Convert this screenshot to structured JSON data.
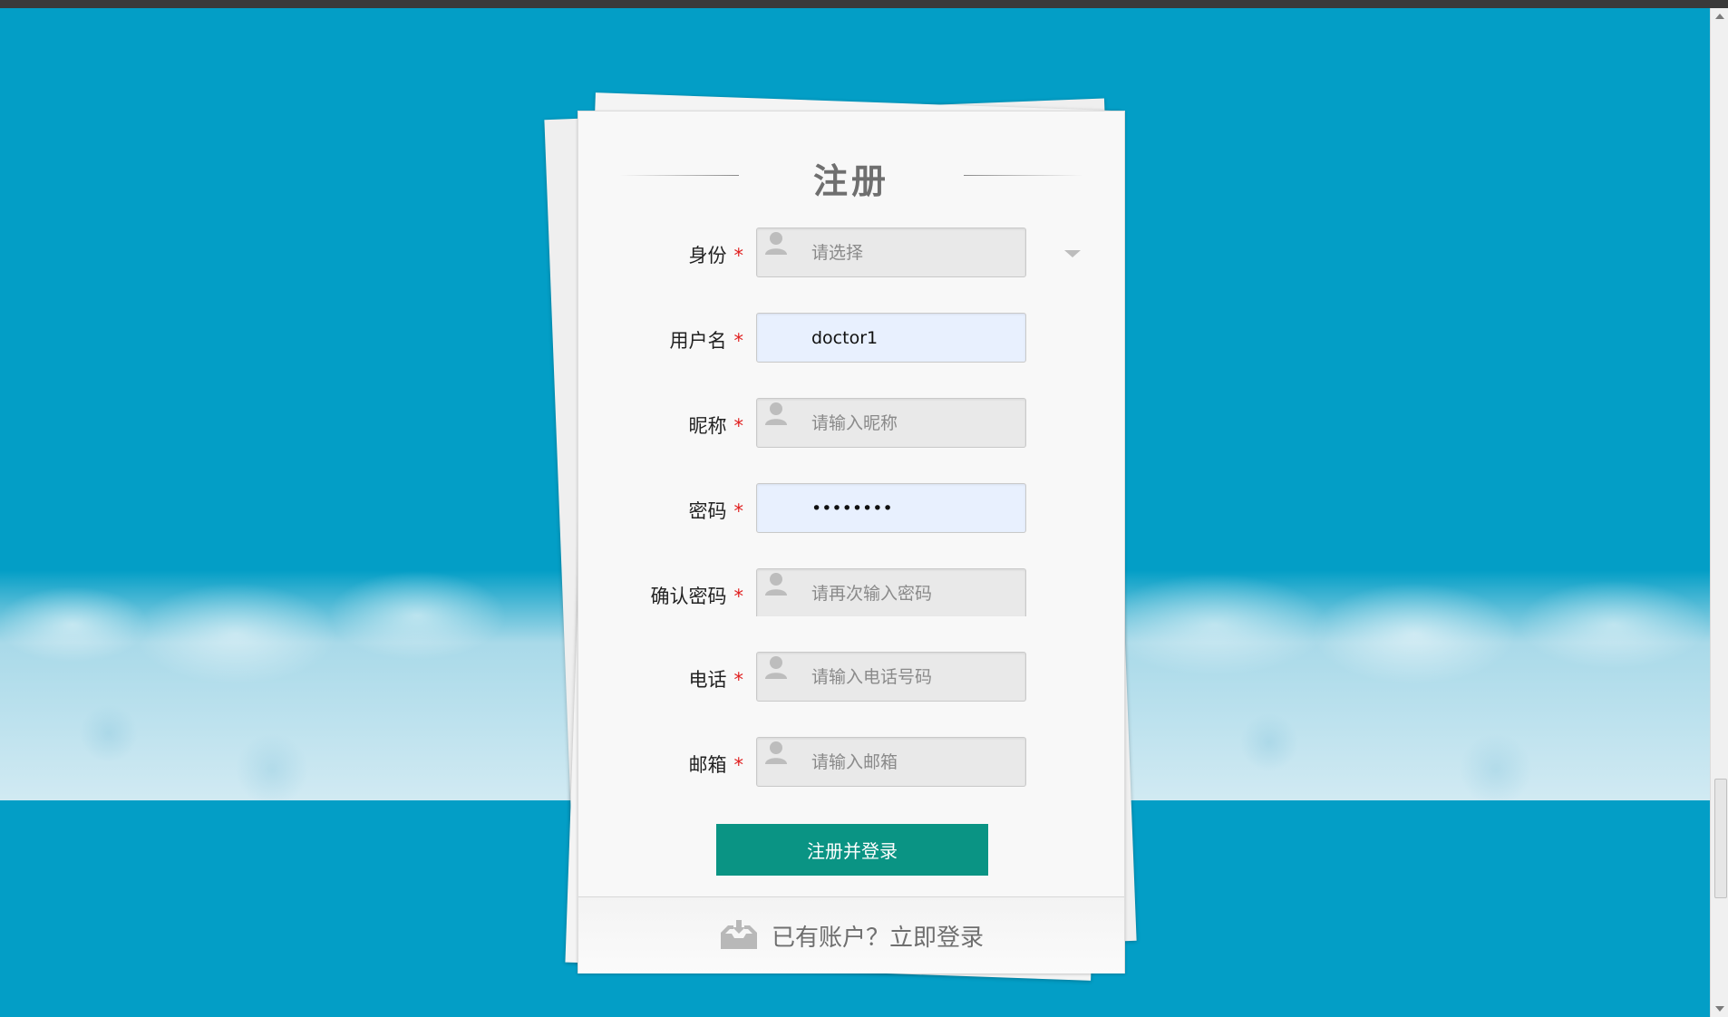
{
  "page": {
    "title": "注册",
    "submit_label": "注册并登录",
    "login_link_label": "已有账户？立即登录"
  },
  "form": {
    "required_mark": "*",
    "fields": [
      {
        "label": "身份",
        "value": "",
        "placeholder": "请选择",
        "type": "select"
      },
      {
        "label": "用户名",
        "value": "doctor1",
        "placeholder": "",
        "type": "text"
      },
      {
        "label": "昵称",
        "value": "",
        "placeholder": "请输入昵称",
        "type": "text"
      },
      {
        "label": "密码",
        "value": "••••••••",
        "placeholder": "",
        "type": "password"
      },
      {
        "label": "确认密码",
        "value": "",
        "placeholder": "请再次输入密码",
        "type": "password"
      },
      {
        "label": "电话",
        "value": "",
        "placeholder": "请输入电话号码",
        "type": "text"
      },
      {
        "label": "邮箱",
        "value": "",
        "placeholder": "请输入邮箱",
        "type": "text"
      }
    ]
  },
  "icons": {
    "field_icon": "user-icon",
    "select_icon": "chevron-down-icon",
    "login_icon": "inbox-tray-icon"
  },
  "colors": {
    "background": "#039ec6",
    "button": "#0a9484",
    "required": "#e02020",
    "autofill": "#e8f0fe"
  }
}
